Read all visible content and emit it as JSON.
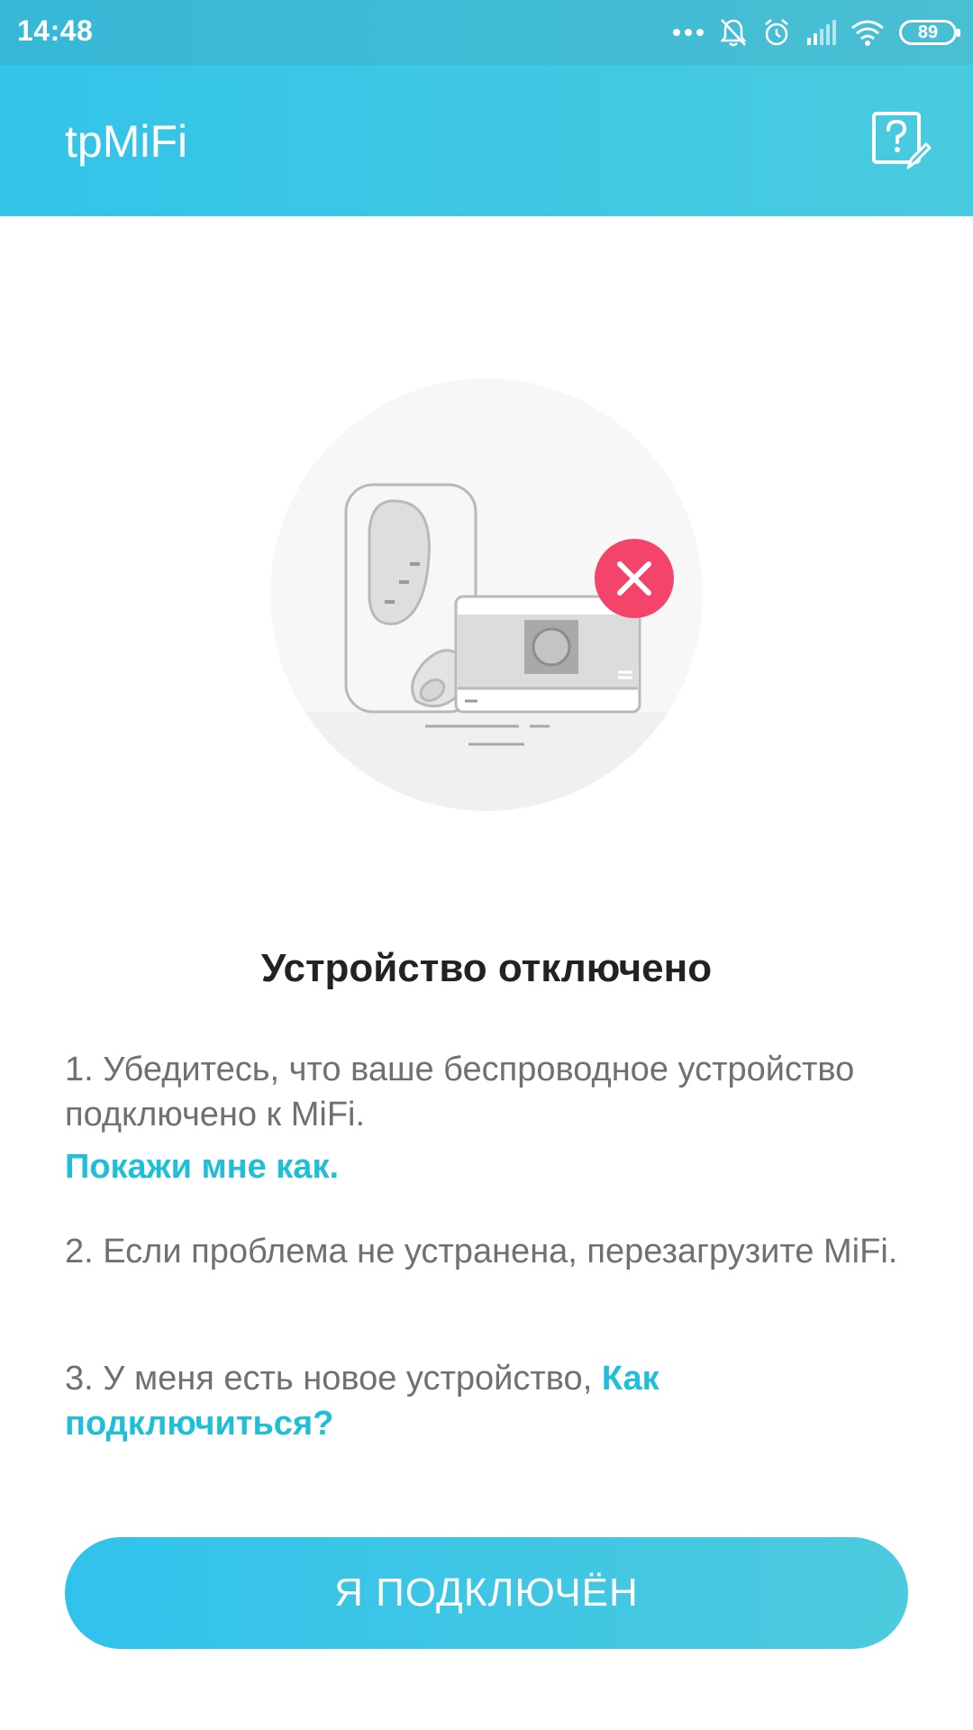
{
  "status_bar": {
    "time": "14:48",
    "battery_level": "89",
    "icons": [
      "more-dots-icon",
      "bell-off-icon",
      "alarm-icon",
      "signal-icon",
      "wifi-icon",
      "battery-icon"
    ]
  },
  "app_bar": {
    "title": "tpMiFi",
    "help_icon": "help-feedback-icon"
  },
  "illustration": {
    "description_icon": "device-disconnected-illustration",
    "status_icon": "error-x-icon",
    "error_color": "#f4446b"
  },
  "content": {
    "heading": "Устройство отключено",
    "step1_text": "1. Убедитесь, что ваше беспроводное устройство подключено к MiFi.",
    "step1_link": "Покажи мне как.",
    "step2_text": "2. Если проблема не устранена, перезагрузите MiFi.",
    "step3_text": "3. У меня есть новое устройство, ",
    "step3_link": "Как подключиться?"
  },
  "button": {
    "label": "Я ПОДКЛЮЧЁН"
  },
  "colors": {
    "accent": "#33c4e9",
    "link": "#1fbfd8",
    "text": "#707070",
    "heading": "#222222"
  }
}
